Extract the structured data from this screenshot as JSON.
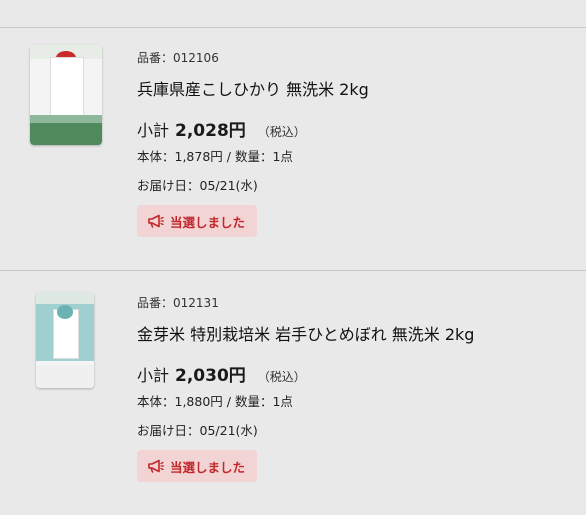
{
  "items": [
    {
      "code_label": "品番：",
      "code": "012106",
      "name": "兵庫県産こしひかり 無洗米 2kg",
      "subtotal_label": "小計",
      "subtotal_amount": "2,028",
      "subtotal_yen": "円",
      "tax_label": "（税込）",
      "detail": "本体：1,878円 / 数量：1点",
      "delivery": "お届け日：05/21(水)",
      "status_label": "当選しました",
      "bag_colors": {
        "band_top": "#8fb89a",
        "band_bottom": "#4e8a5c"
      }
    },
    {
      "code_label": "品番：",
      "code": "012131",
      "name": "金芽米 特別栽培米 岩手ひとめぼれ 無洗米 2kg",
      "subtotal_label": "小計",
      "subtotal_amount": "2,030",
      "subtotal_yen": "円",
      "tax_label": "（税込）",
      "detail": "本体：1,880円 / 数量：1点",
      "delivery": "お届け日：05/21(水)",
      "status_label": "当選しました",
      "bag_colors": {
        "band_top": "#9fd0cf",
        "band_bottom": "#6bb3b2"
      }
    }
  ],
  "colors": {
    "status_bg": "#f3d4d4",
    "status_text": "#c0282b"
  },
  "icons": {
    "status": "megaphone-icon"
  }
}
